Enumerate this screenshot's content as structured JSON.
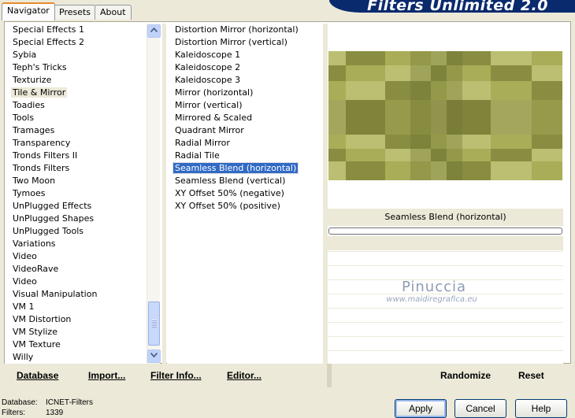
{
  "tabs": [
    {
      "label": "Navigator",
      "active": true
    },
    {
      "label": "Presets",
      "active": false
    },
    {
      "label": "About",
      "active": false
    }
  ],
  "banner": {
    "title": "Filters Unlimited 2.0"
  },
  "categories": {
    "items": [
      "Special Effects 1",
      "Special Effects 2",
      "Sybia",
      "Teph's Tricks",
      "Texturize",
      "Tile & Mirror",
      "Toadies",
      "Tools",
      "Tramages",
      "Transparency",
      "Tronds Filters II",
      "Tronds Filters",
      "Two Moon",
      "Tymoes",
      "UnPlugged Effects",
      "UnPlugged Shapes",
      "UnPlugged Tools",
      "Variations",
      "Video",
      "VideoRave",
      "Video",
      "Visual Manipulation",
      "VM 1",
      "VM Distortion",
      "VM Stylize",
      "VM Texture",
      "Willy"
    ],
    "selected": "Tile & Mirror"
  },
  "filters": {
    "items": [
      "Distortion Mirror (horizontal)",
      "Distortion Mirror (vertical)",
      "Kaleidoscope 1",
      "Kaleidoscope 2",
      "Kaleidoscope 3",
      "Mirror (horizontal)",
      "Mirror (vertical)",
      "Mirrored & Scaled",
      "Quadrant Mirror",
      "Radial Mirror",
      "Radial Tile",
      "Seamless Blend (horizontal)",
      "Seamless Blend (vertical)",
      "XY Offset 50% (negative)",
      "XY Offset 50% (positive)"
    ],
    "selected": "Seamless Blend (horizontal)"
  },
  "preview": {
    "filter_name": "Seamless Blend (horizontal)",
    "palette": {
      "light": "#C9CD86",
      "mid": "#A9AD57",
      "dark": "#6E7230"
    }
  },
  "watermark": {
    "title": "Pinuccia",
    "url": "www.maidiregrafica.eu"
  },
  "left_buttons": {
    "database": "Database",
    "import": "Import...",
    "filter_info": "Filter Info...",
    "editor": "Editor..."
  },
  "right_buttons": {
    "randomize": "Randomize",
    "reset": "Reset"
  },
  "status": {
    "database_label": "Database:",
    "database_value": "ICNET-Filters",
    "filters_label": "Filters:",
    "filters_value": "1339"
  },
  "dialog_buttons": {
    "apply": "Apply",
    "cancel": "Cancel",
    "help": "Help"
  },
  "colors": {
    "accent_selection": "#316AC5",
    "banner": "#0A2A6E",
    "dialog_bg": "#ECE9D8"
  }
}
